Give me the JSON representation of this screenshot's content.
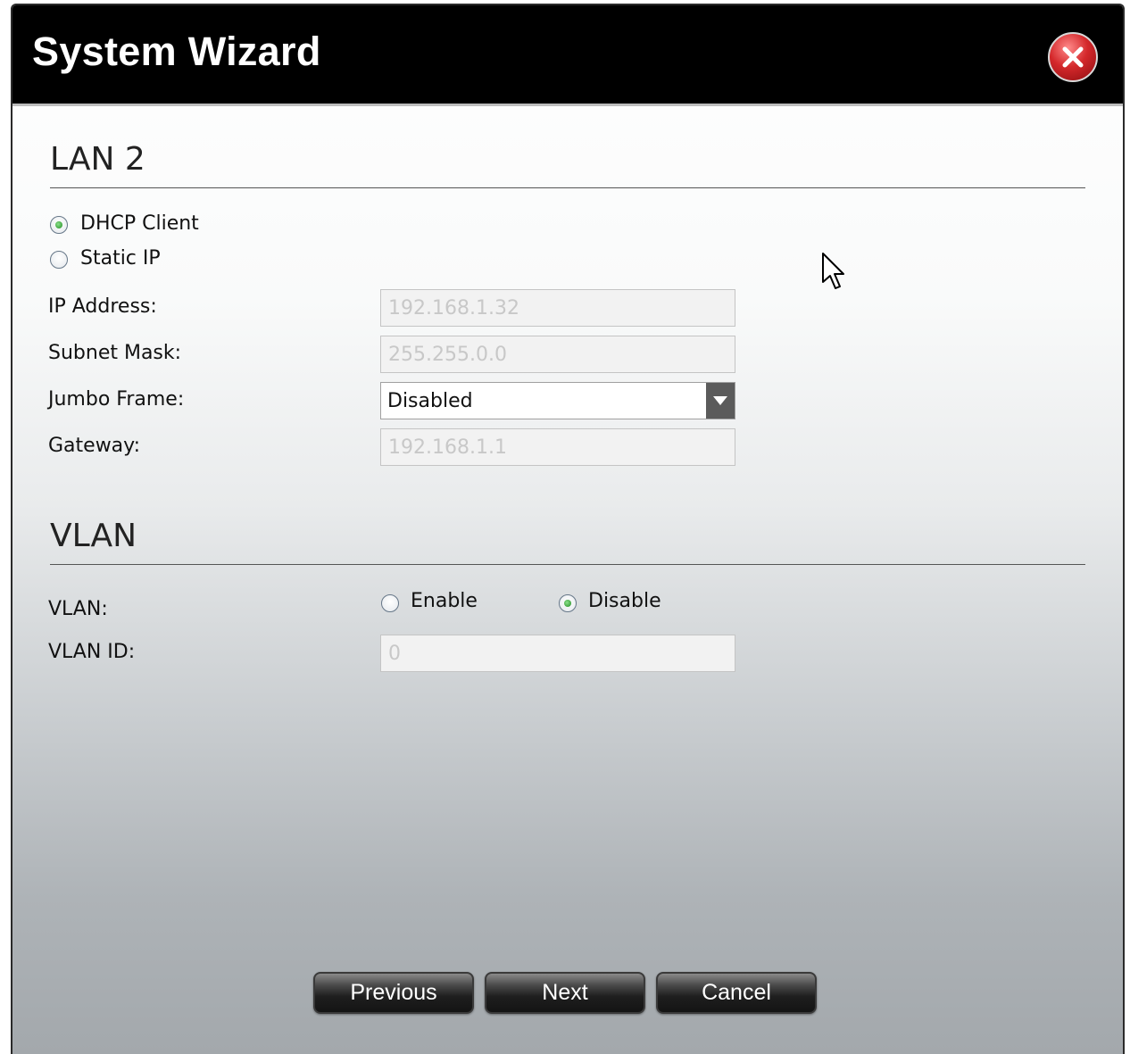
{
  "window": {
    "title": "System Wizard",
    "close_icon": "close-icon"
  },
  "lan2": {
    "heading": "LAN 2",
    "mode_options": [
      {
        "label": "DHCP Client",
        "checked": true
      },
      {
        "label": "Static IP",
        "checked": false
      }
    ],
    "ip_address": {
      "label": "IP Address:",
      "value": "192.168.1.32"
    },
    "subnet_mask": {
      "label": "Subnet Mask:",
      "value": "255.255.0.0"
    },
    "jumbo_frame": {
      "label": "Jumbo Frame:",
      "value": "Disabled"
    },
    "gateway": {
      "label": "Gateway:",
      "value": "192.168.1.1"
    }
  },
  "vlan": {
    "heading": "VLAN",
    "vlan_label": "VLAN:",
    "enable_label": "Enable",
    "enable_checked": false,
    "disable_label": "Disable",
    "disable_checked": true,
    "vlan_id": {
      "label": "VLAN ID:",
      "value": "0"
    }
  },
  "footer": {
    "previous_label": "Previous",
    "next_label": "Next",
    "cancel_label": "Cancel"
  },
  "colors": {
    "titlebar": "#000000",
    "close_button": "#d4282b",
    "radio_selected": "#1e8a1e"
  }
}
